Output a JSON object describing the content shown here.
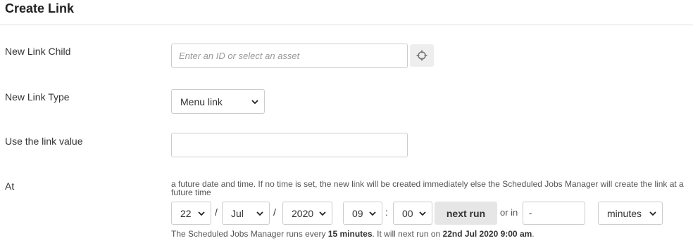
{
  "title": "Create Link",
  "rows": {
    "child_label": "New Link Child",
    "type_label": "New Link Type",
    "value_label": "Use the link value",
    "at_label": "At"
  },
  "child_input": {
    "placeholder": "Enter an ID or select an asset",
    "value": ""
  },
  "link_type": {
    "selected": "Menu link"
  },
  "link_value": {
    "value": ""
  },
  "schedule": {
    "help": "a future date and time. If no time is set, the new link will be created immediately else the Scheduled Jobs Manager will create the link at a future time",
    "day": "22",
    "month": "Jul",
    "year": "2020",
    "hour": "09",
    "minute": "00",
    "date_sep_1": "/",
    "date_sep_2": "/",
    "time_sep": ":",
    "next_run_label": "next run",
    "or_in_label": "or in",
    "or_in_value": "-",
    "unit": "minutes"
  },
  "footer": {
    "prefix": "The Scheduled Jobs Manager runs every ",
    "interval": "15 minutes",
    "middle": ". It will next run on ",
    "next_time": "22nd Jul 2020 9:00 am",
    "suffix": "."
  },
  "icons": {
    "asset_picker": "crosshair-icon",
    "dropdown": "chevron-down-icon"
  }
}
